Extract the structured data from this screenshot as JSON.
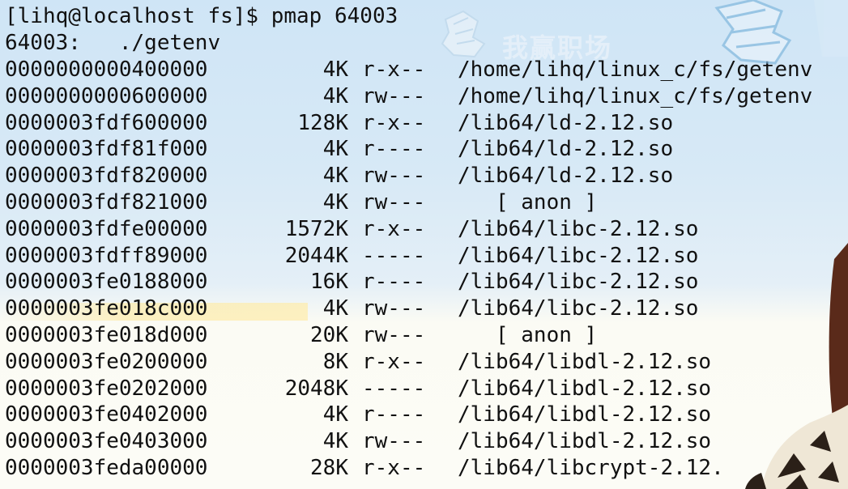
{
  "terminal": {
    "prompt_line": "[lihq@localhost fs]$ pmap 64003",
    "header_line": "64003:   ./getenv",
    "rows": [
      {
        "address": "0000000000400000",
        "size": "4K",
        "perm": "r-x--",
        "mapping": "/home/lihq/linux_c/fs/getenv"
      },
      {
        "address": "0000000000600000",
        "size": "4K",
        "perm": "rw---",
        "mapping": "/home/lihq/linux_c/fs/getenv"
      },
      {
        "address": "0000003fdf600000",
        "size": "128K",
        "perm": "r-x--",
        "mapping": "/lib64/ld-2.12.so"
      },
      {
        "address": "0000003fdf81f000",
        "size": "4K",
        "perm": "r----",
        "mapping": "/lib64/ld-2.12.so"
      },
      {
        "address": "0000003fdf820000",
        "size": "4K",
        "perm": "rw---",
        "mapping": "/lib64/ld-2.12.so"
      },
      {
        "address": "0000003fdf821000",
        "size": "4K",
        "perm": "rw---",
        "mapping": "   [ anon ]"
      },
      {
        "address": "0000003fdfe00000",
        "size": "1572K",
        "perm": "r-x--",
        "mapping": "/lib64/libc-2.12.so"
      },
      {
        "address": "0000003fdff89000",
        "size": "2044K",
        "perm": "-----",
        "mapping": "/lib64/libc-2.12.so"
      },
      {
        "address": "0000003fe0188000",
        "size": "16K",
        "perm": "r----",
        "mapping": "/lib64/libc-2.12.so"
      },
      {
        "address": "0000003fe018c000",
        "size": "4K",
        "perm": "rw---",
        "mapping": "/lib64/libc-2.12.so"
      },
      {
        "address": "0000003fe018d000",
        "size": "20K",
        "perm": "rw---",
        "mapping": "   [ anon ]"
      },
      {
        "address": "0000003fe0200000",
        "size": "8K",
        "perm": "r-x--",
        "mapping": "/lib64/libdl-2.12.so"
      },
      {
        "address": "0000003fe0202000",
        "size": "2048K",
        "perm": "-----",
        "mapping": "/lib64/libdl-2.12.so"
      },
      {
        "address": "0000003fe0402000",
        "size": "4K",
        "perm": "r----",
        "mapping": "/lib64/libdl-2.12.so"
      },
      {
        "address": "0000003fe0403000",
        "size": "4K",
        "perm": "rw---",
        "mapping": "/lib64/libdl-2.12.so"
      },
      {
        "address": "0000003feda00000",
        "size": "28K",
        "perm": "r-x--",
        "mapping": "/lib64/libcrypt-2.12."
      }
    ]
  },
  "watermark": {
    "text": "我赢职场"
  },
  "colors": {
    "text": "#111111",
    "bg_top": "#cfe5f6",
    "bg_bottom": "#fbfbf6"
  }
}
